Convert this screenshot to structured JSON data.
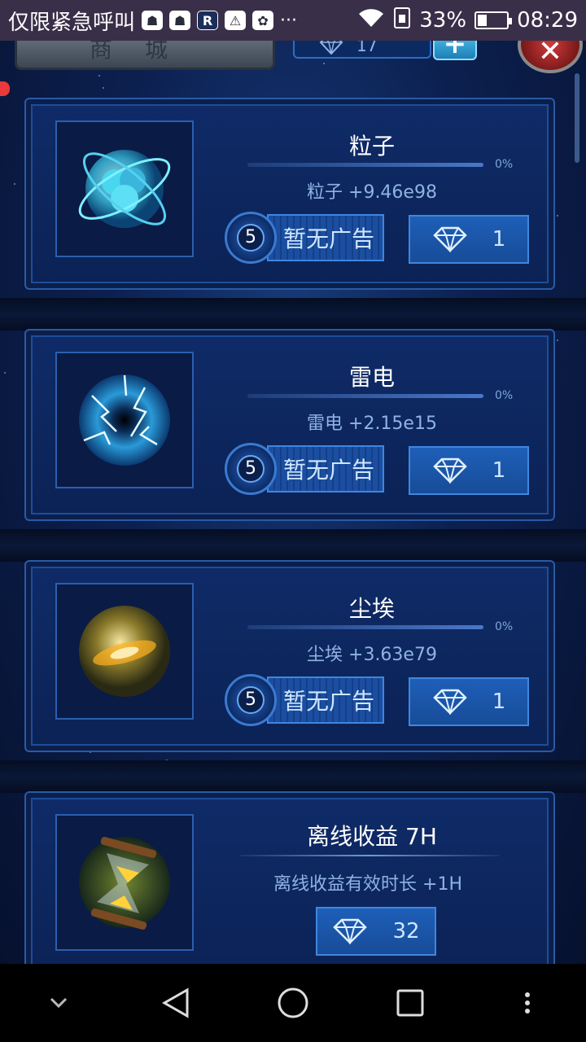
{
  "status_bar": {
    "carrier": "仅限紧急呼叫",
    "notification_icons": [
      "ghost-icon",
      "ghost-icon",
      "r-app-icon",
      "warning-icon",
      "app-icon"
    ],
    "more": "···",
    "battery": "33%",
    "battery_level": 0.33,
    "time": "08:29"
  },
  "header": {
    "tab_label": "商城",
    "gem_count": "17"
  },
  "items": [
    {
      "title": "粒子",
      "progress_label": "0%",
      "progress": 0,
      "desc": "粒子 +9.46e98",
      "ad_count": "5",
      "ad_label": "暂无广告",
      "gem_cost": "1",
      "icon": "particle-icon"
    },
    {
      "title": "雷电",
      "progress_label": "0%",
      "progress": 0,
      "desc": "雷电 +2.15e15",
      "ad_count": "5",
      "ad_label": "暂无广告",
      "gem_cost": "1",
      "icon": "lightning-icon"
    },
    {
      "title": "尘埃",
      "progress_label": "0%",
      "progress": 0,
      "desc": "尘埃 +3.63e79",
      "ad_count": "5",
      "ad_label": "暂无广告",
      "gem_cost": "1",
      "icon": "dust-icon"
    }
  ],
  "offline": {
    "title": "离线收益 7H",
    "desc": "离线收益有效时长  +1H",
    "gem_cost": "32",
    "icon": "hourglass-icon"
  },
  "nav": [
    "chevron-down-icon",
    "back-icon",
    "home-icon",
    "recents-icon",
    "more-vert-icon"
  ]
}
